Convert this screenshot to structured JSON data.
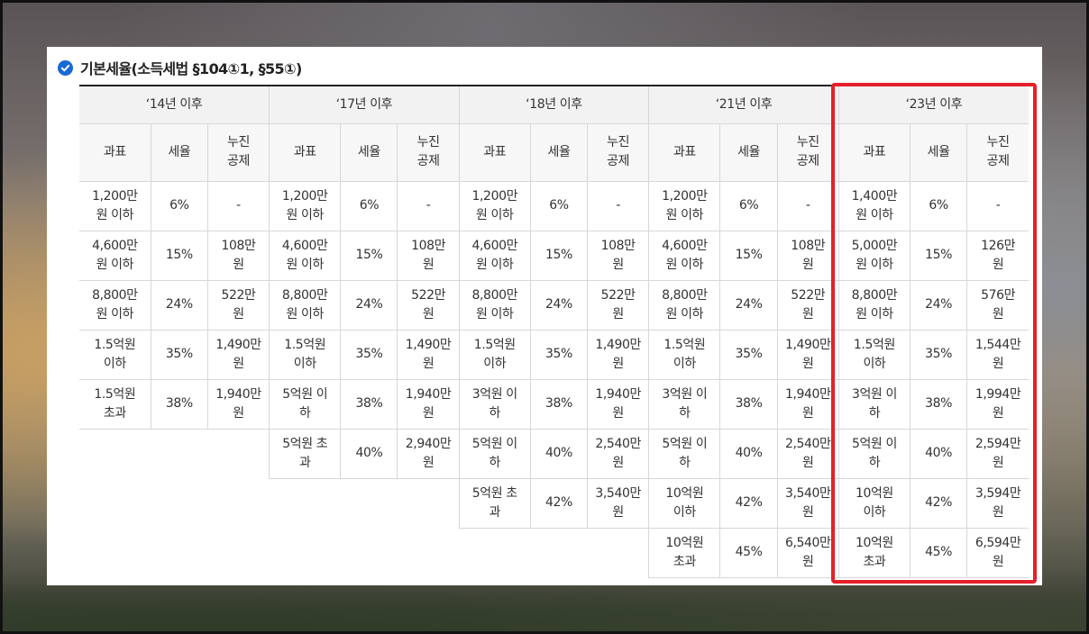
{
  "title": "기본세율(소득세법 §104①1, §55①)",
  "periods": [
    "‘14년 이후",
    "‘17년 이후",
    "‘18년 이후",
    "‘21년 이후",
    "‘23년 이후"
  ],
  "columns": [
    "과표",
    "세율",
    "누진\n공제"
  ],
  "table": {
    "p14": [
      [
        "1,200만\n원 이하",
        "6%",
        "-"
      ],
      [
        "4,600만\n원 이하",
        "15%",
        "108만\n원"
      ],
      [
        "8,800만\n원 이하",
        "24%",
        "522만\n원"
      ],
      [
        "1.5억원\n이하",
        "35%",
        "1,490만\n원"
      ],
      [
        "1.5억원\n초과",
        "38%",
        "1,940만\n원"
      ]
    ],
    "p17": [
      [
        "1,200만\n원 이하",
        "6%",
        "-"
      ],
      [
        "4,600만\n원 이하",
        "15%",
        "108만\n원"
      ],
      [
        "8,800만\n원 이하",
        "24%",
        "522만\n원"
      ],
      [
        "1.5억원\n이하",
        "35%",
        "1,490만\n원"
      ],
      [
        "5억원 이\n하",
        "38%",
        "1,940만\n원"
      ],
      [
        "5억원 초\n과",
        "40%",
        "2,940만\n원"
      ]
    ],
    "p18": [
      [
        "1,200만\n원 이하",
        "6%",
        "-"
      ],
      [
        "4,600만\n원 이하",
        "15%",
        "108만\n원"
      ],
      [
        "8,800만\n원 이하",
        "24%",
        "522만\n원"
      ],
      [
        "1.5억원\n이하",
        "35%",
        "1,490만\n원"
      ],
      [
        "3억원 이\n하",
        "38%",
        "1,940만\n원"
      ],
      [
        "5억원 이\n하",
        "40%",
        "2,540만\n원"
      ],
      [
        "5억원 초\n과",
        "42%",
        "3,540만\n원"
      ]
    ],
    "p21": [
      [
        "1,200만\n원 이하",
        "6%",
        "-"
      ],
      [
        "4,600만\n원 이하",
        "15%",
        "108만\n원"
      ],
      [
        "8,800만\n원 이하",
        "24%",
        "522만\n원"
      ],
      [
        "1.5억원\n이하",
        "35%",
        "1,490만\n원"
      ],
      [
        "3억원 이\n하",
        "38%",
        "1,940만\n원"
      ],
      [
        "5억원 이\n하",
        "40%",
        "2,540만\n원"
      ],
      [
        "10억원\n이하",
        "42%",
        "3,540만\n원"
      ],
      [
        "10억원\n초과",
        "45%",
        "6,540만\n원"
      ]
    ],
    "p23": [
      [
        "1,400만\n원 이하",
        "6%",
        "-"
      ],
      [
        "5,000만\n원 이하",
        "15%",
        "126만\n원"
      ],
      [
        "8,800만\n원 이하",
        "24%",
        "576만\n원"
      ],
      [
        "1.5억원\n이하",
        "35%",
        "1,544만\n원"
      ],
      [
        "3억원 이\n하",
        "38%",
        "1,994만\n원"
      ],
      [
        "5억원 이\n하",
        "40%",
        "2,594만\n원"
      ],
      [
        "10억원\n이하",
        "42%",
        "3,594만\n원"
      ],
      [
        "10억원\n초과",
        "45%",
        "6,594만\n원"
      ]
    ]
  },
  "colors": {
    "highlight_border": "#e4202a",
    "check_icon": "#1769d6"
  },
  "icons": {
    "title_marker": "check-circle-icon"
  }
}
